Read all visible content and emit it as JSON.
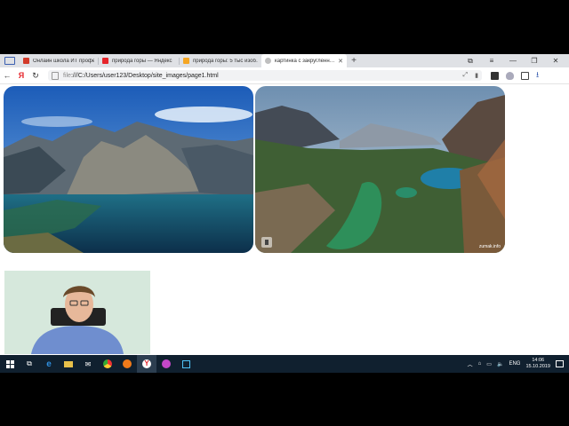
{
  "browser": {
    "tabs": [
      {
        "title": "Онлайн школа ИТ профе…",
        "favicon_color": "#d23a2a",
        "active": false
      },
      {
        "title": "природа горы — Яндекс",
        "favicon_color": "#e6252b",
        "active": false
      },
      {
        "title": "природа горы: 5 тыс изоб…",
        "favicon_color": "#f5a623",
        "active": false
      },
      {
        "title": "картинка с закругленн…",
        "favicon_color": "#bfbfbf",
        "active": true
      }
    ],
    "new_tab_label": "+",
    "url_scheme": "file",
    "url_path": ":///C:/Users/user123/Desktop/site_images/page1.html",
    "window_controls": {
      "menu": "≡",
      "minimize": "—",
      "maximize": "❐",
      "close": "✕"
    }
  },
  "page": {
    "image2_watermark": "zumak.info"
  },
  "taskbar": {
    "lang": "ENG",
    "time": "14:06",
    "date": "15.10.2019"
  },
  "colors": {
    "accent": "#3a5fb0",
    "taskbar": "#10202f"
  }
}
